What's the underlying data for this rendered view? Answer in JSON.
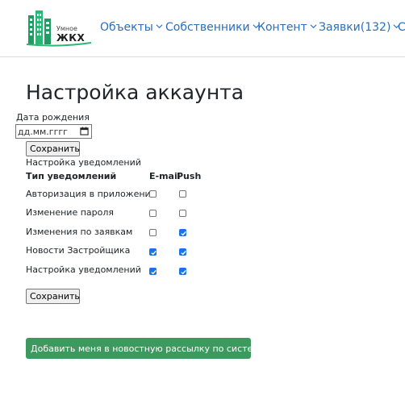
{
  "header": {
    "logo": {
      "line1": "Умное",
      "line2": "ЖКХ"
    },
    "nav": [
      {
        "label": "Объекты",
        "dropdown": true
      },
      {
        "label": "Собственники",
        "dropdown": true
      },
      {
        "label": "Контент",
        "dropdown": true
      },
      {
        "label": "Заявки(132)",
        "dropdown": true
      },
      {
        "label": "С",
        "dropdown": false
      }
    ]
  },
  "page": {
    "title": "Настройка аккаунта",
    "birth_date": {
      "label": "Дата рождения",
      "placeholder": "дд.мм.гггг"
    },
    "save_label": "Сохранить",
    "notifications": {
      "caption": "Настройка уведомлений",
      "headers": {
        "type": "Тип уведомлений",
        "email": "E-mail",
        "push": "Push"
      },
      "rows": [
        {
          "label": "Авторизация в приложении",
          "email": false,
          "push": false
        },
        {
          "label": "Изменение пароля",
          "email": false,
          "push": false
        },
        {
          "label": "Изменения по заявкам",
          "email": false,
          "push": true
        },
        {
          "label": "Новости Застройщика",
          "email": true,
          "push": true
        },
        {
          "label": "Настройка уведомлений",
          "email": true,
          "push": true
        }
      ]
    },
    "subscribe_label": "Добавить меня в новостную рассылку по системе"
  },
  "colors": {
    "link": "#2a6ebb",
    "checkbox_checked": "#1a73e8",
    "subscribe_button": "#3c9a5f",
    "logo_green": "#1f9b63"
  }
}
